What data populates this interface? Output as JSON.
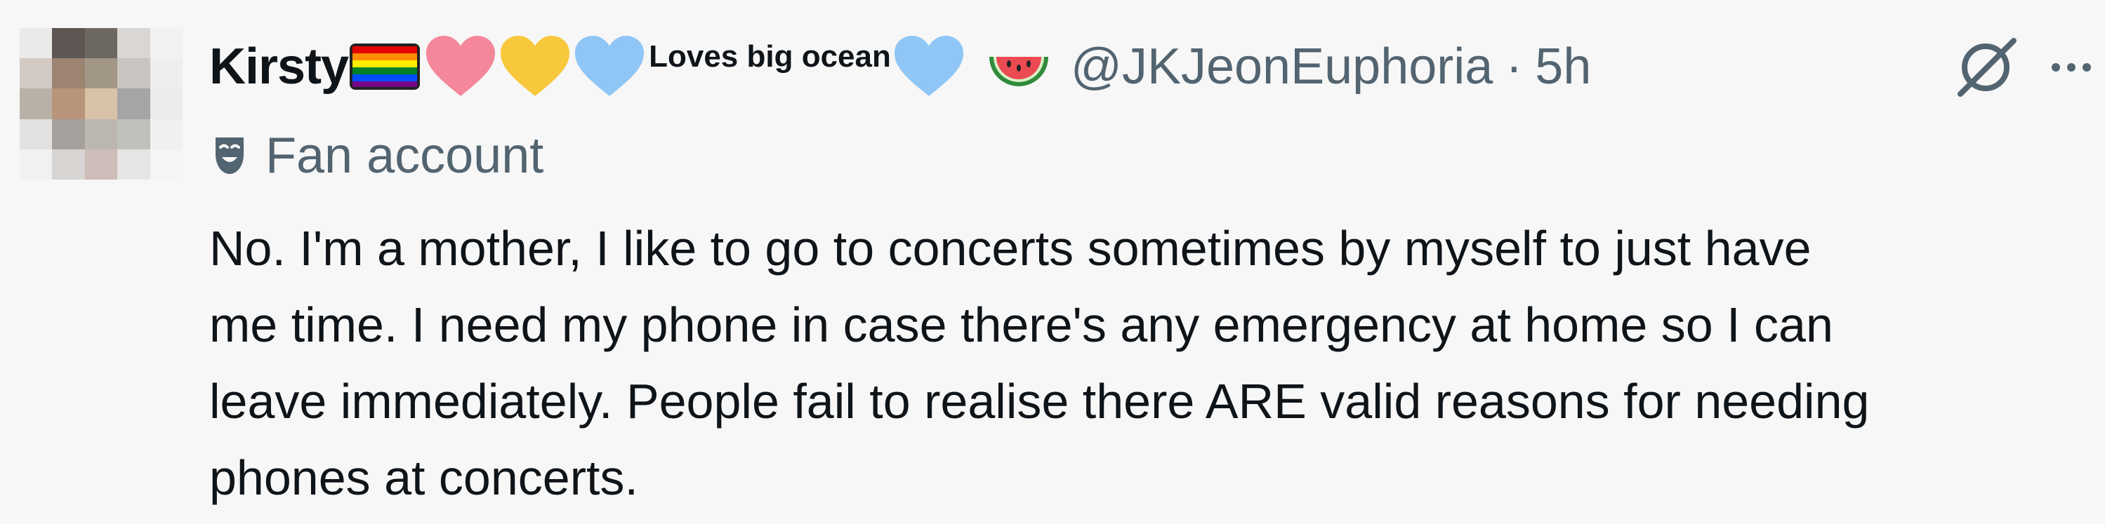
{
  "tweet": {
    "display_name": "Kirsty",
    "name_suffix_text": "Loves big ocean",
    "name_emojis": [
      "rainbow-flag",
      "pink-heart",
      "yellow-heart",
      "light-blue-heart",
      "light-blue-heart",
      "watermelon"
    ],
    "handle": "@JKJeonEuphoria",
    "separator": "·",
    "timestamp": "5h",
    "label": "Fan account",
    "label_icon": "theater-masks-icon",
    "body_lines": [
      "No. I'm a mother, I like to go to concerts sometimes by myself to just have",
      "me time. I need my phone in case there's any emergency at home so I can",
      "leave immediately. People fail to realise there ARE valid reasons for needing",
      "phones at concerts."
    ]
  },
  "colors": {
    "background": "#f7f7f7",
    "text_primary": "#0f1419",
    "text_secondary": "#536471"
  }
}
